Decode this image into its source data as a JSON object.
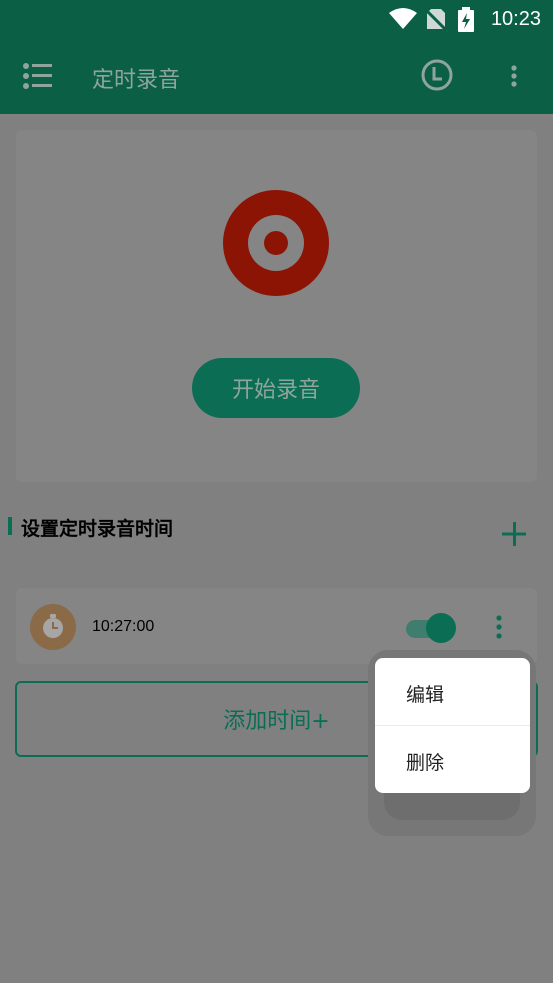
{
  "status_bar": {
    "time": "10:23",
    "icons": [
      "wifi-icon",
      "no-sim-icon",
      "battery-charging-icon"
    ]
  },
  "toolbar": {
    "title": "定时录音",
    "menu_icon": "list-menu-icon",
    "clock_icon": "clock-icon",
    "more_icon": "more-vertical-icon"
  },
  "record": {
    "icon": "record-icon",
    "start_label": "开始录音"
  },
  "schedule": {
    "section_title": "设置定时录音时间",
    "add_icon": "plus-icon",
    "items": [
      {
        "time": "10:27:00",
        "enabled": true,
        "icon": "stopwatch-icon"
      }
    ],
    "add_time_label": "添加时间+"
  },
  "popup_menu": {
    "items": [
      {
        "label": "编辑"
      },
      {
        "label": "删除"
      }
    ]
  },
  "colors": {
    "primary": "#0b6e54",
    "toolbar_bg": "#0b5f45",
    "record_red": "#8b1405",
    "overlay_bg": "#808080",
    "timer_avatar": "#8a6a47"
  }
}
